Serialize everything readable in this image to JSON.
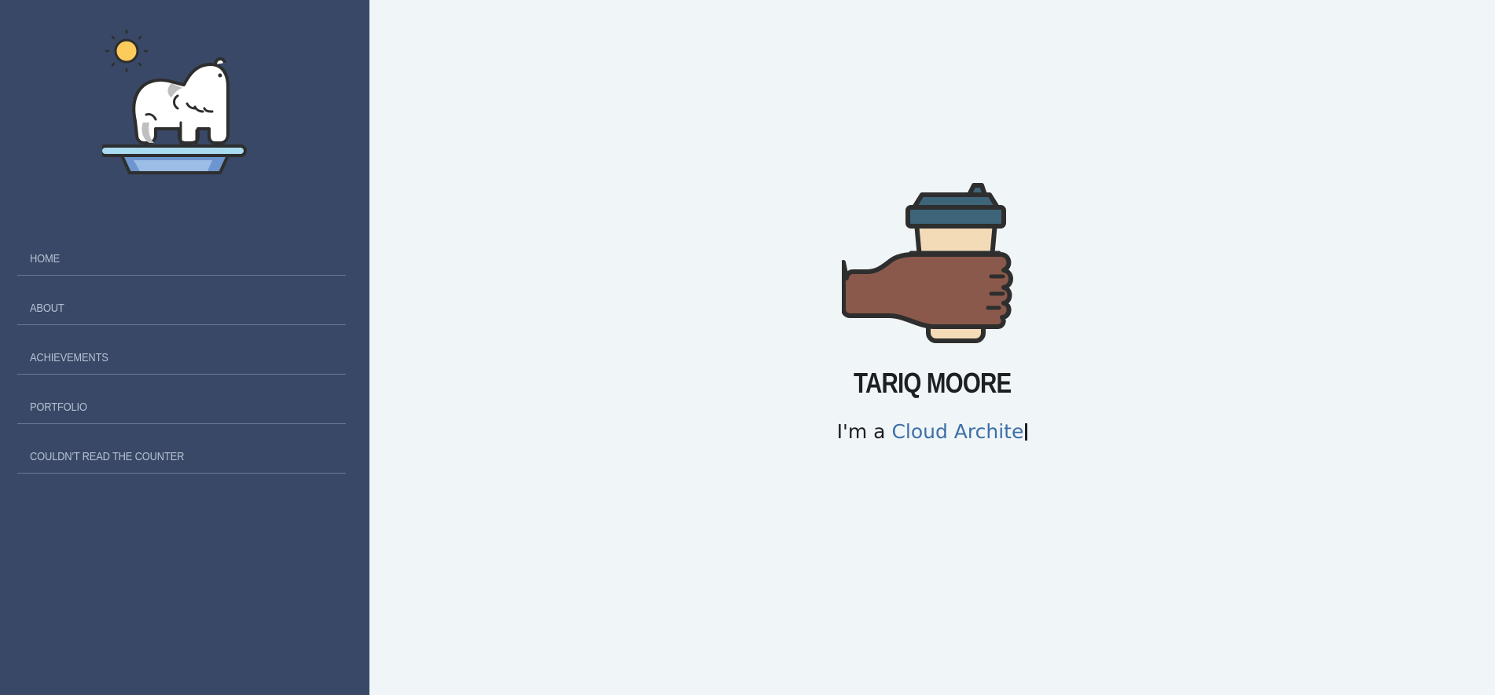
{
  "sidebar": {
    "logo_icon": "polar-bear-on-ice-icon",
    "nav": [
      {
        "label": "HOME"
      },
      {
        "label": "ABOUT"
      },
      {
        "label": "ACHIEVEMENTS"
      },
      {
        "label": "PORTFOLIO"
      },
      {
        "label": "COULDN'T READ THE COUNTER"
      }
    ]
  },
  "hero": {
    "icon": "hand-holding-coffee-icon",
    "name": "TARIQ MOORE",
    "tagline_prefix": "I'm a ",
    "tagline_role": "Cloud Archite"
  },
  "colors": {
    "sidebar_bg": "#384866",
    "main_bg": "#f0f5f8",
    "accent": "#3d6fa7",
    "nav_text": "#b8c1d3"
  }
}
